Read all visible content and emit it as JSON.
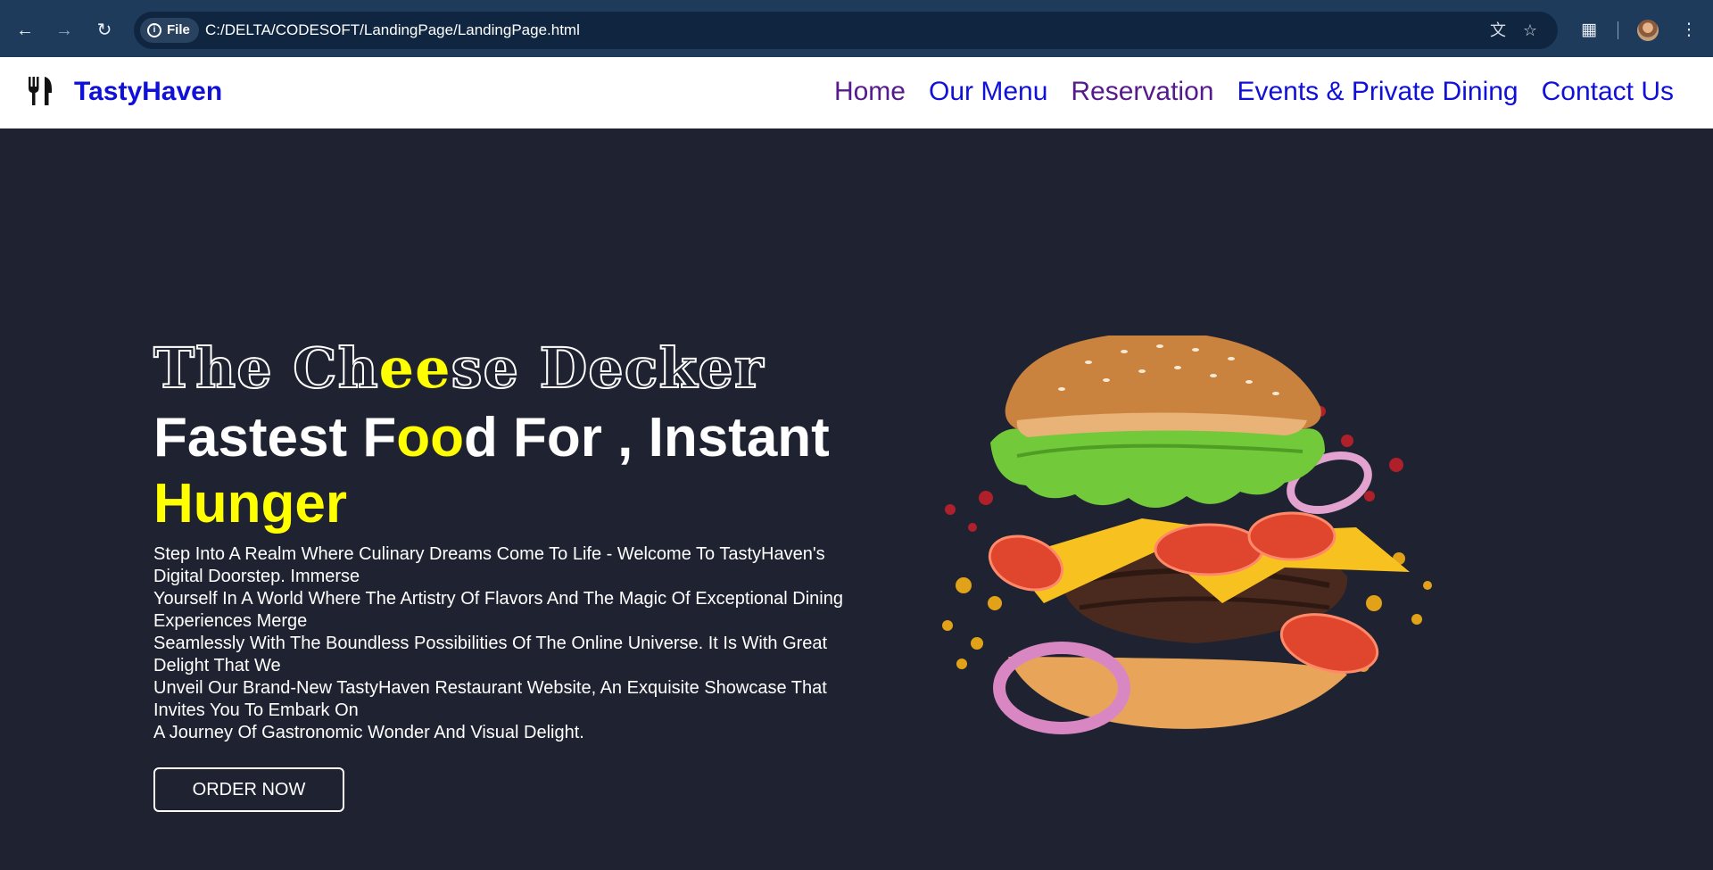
{
  "browser": {
    "back_icon": "arrow-left-icon",
    "forward_icon": "arrow-right-icon",
    "reload_icon": "reload-icon",
    "file_chip": "File",
    "url": "C:/DELTA/CODESOFT/LandingPage/LandingPage.html",
    "translate_icon": "translate-icon",
    "bookmark_icon": "star-icon",
    "extensions_icon": "puzzle-icon",
    "menu_icon": "kebab-menu-icon"
  },
  "site": {
    "brand": "TastyHaven",
    "logo_icon": "fork-knife-icon",
    "nav": [
      {
        "label": "Home",
        "visited": true
      },
      {
        "label": "Our Menu",
        "visited": false
      },
      {
        "label": "Reservation",
        "visited": true
      },
      {
        "label": "Events & Private Dining",
        "visited": false
      },
      {
        "label": "Contact Us",
        "visited": false
      }
    ]
  },
  "hero": {
    "kicker": {
      "part1": "The Ch",
      "highlight": "ee",
      "part2": "se Decker"
    },
    "headline": {
      "part1": "Fastest F",
      "highlight1": "oo",
      "part2": "d For , Instant",
      "highlight2": "Hunger"
    },
    "description_lines": [
      "Step Into A Realm Where Culinary Dreams Come To Life - Welcome To TastyHaven's",
      "Digital Doorstep. Immerse",
      "Yourself In A World Where The Artistry Of Flavors And The Magic Of Exceptional Dining",
      "Experiences Merge",
      "Seamlessly With The Boundless Possibilities Of The Online Universe. It Is With Great",
      "Delight That We",
      "Unveil Our Brand-New TastyHaven Restaurant Website, An Exquisite Showcase That",
      "Invites You To Embark On",
      "A Journey Of Gastronomic Wonder And Visual Delight."
    ],
    "cta": "ORDER NOW",
    "image": "cheeseburger-image"
  },
  "colors": {
    "hero_bg": "#1f2230",
    "highlight": "#ffff00",
    "link": "#1010d8",
    "visited_link": "#551a8b",
    "chrome_bg": "#1f3b5c"
  }
}
